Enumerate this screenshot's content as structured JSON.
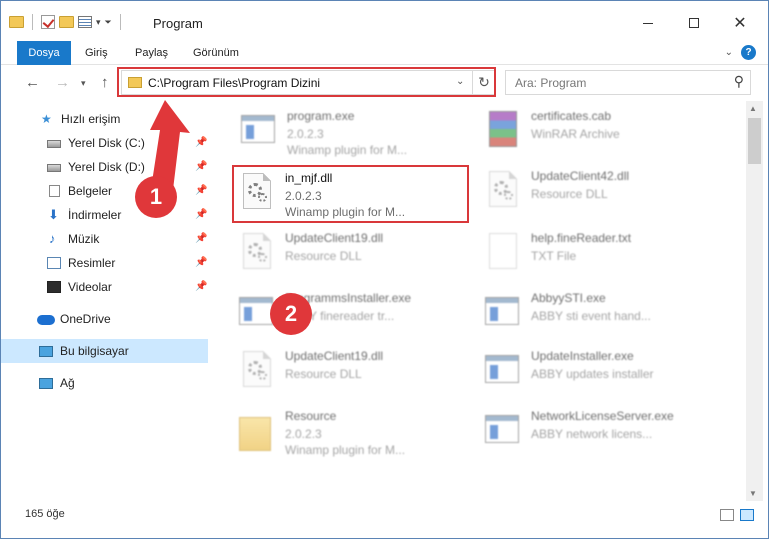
{
  "window": {
    "title": "Program"
  },
  "ribbon": {
    "tabs": [
      "Dosya",
      "Giriş",
      "Paylaş",
      "Görünüm"
    ],
    "help": "?"
  },
  "nav": {
    "address": "C:\\Program Files\\Program Dizini",
    "search_placeholder": "Ara: Program"
  },
  "sidebar": {
    "items": [
      {
        "label": "Hızlı erişim",
        "icon": "star-icon"
      },
      {
        "label": "Yerel Disk (C:)",
        "icon": "drive-icon"
      },
      {
        "label": "Yerel Disk (D:)",
        "icon": "drive-icon"
      },
      {
        "label": "Belgeler",
        "icon": "documents-icon"
      },
      {
        "label": "İndirmeler",
        "icon": "download-icon"
      },
      {
        "label": "Müzik",
        "icon": "music-icon"
      },
      {
        "label": "Resimler",
        "icon": "pictures-icon"
      },
      {
        "label": "Videolar",
        "icon": "videos-icon"
      },
      {
        "label": "OneDrive",
        "icon": "cloud-icon"
      },
      {
        "label": "Bu bilgisayar",
        "icon": "computer-icon"
      },
      {
        "label": "Ağ",
        "icon": "network-icon"
      }
    ]
  },
  "files": {
    "left": [
      {
        "name": "program.exe",
        "line2": "2.0.2.3",
        "line3": "Winamp plugin for M..."
      },
      {
        "name": "in_mjf.dll",
        "line2": "2.0.2.3",
        "line3": "Winamp plugin for M..."
      },
      {
        "name": "UpdateClient19.dll",
        "line2": "Resource DLL",
        "line3": ""
      },
      {
        "name": "ProgrammsInstaller.exe",
        "line2": "ABBY finereader tr...",
        "line3": ""
      },
      {
        "name": "UpdateClient19.dll",
        "line2": "Resource DLL",
        "line3": ""
      },
      {
        "name": "Resource",
        "line2": "2.0.2.3",
        "line3": "Winamp plugin for M..."
      }
    ],
    "right": [
      {
        "name": "certificates.cab",
        "line2": "WinRAR Archive",
        "line3": ""
      },
      {
        "name": "UpdateClient42.dll",
        "line2": "Resource DLL",
        "line3": ""
      },
      {
        "name": "help.fineReader.txt",
        "line2": "TXT File",
        "line3": ""
      },
      {
        "name": "AbbyySTI.exe",
        "line2": "ABBY sti event hand...",
        "line3": ""
      },
      {
        "name": "UpdateInstaller.exe",
        "line2": "ABBY updates installer",
        "line3": ""
      },
      {
        "name": "NetworkLicenseServer.exe",
        "line2": "ABBY network licens...",
        "line3": ""
      }
    ]
  },
  "status": {
    "count": "165 öğe"
  },
  "callouts": [
    "1",
    "2"
  ],
  "colors": {
    "accent": "#1979ca",
    "highlight": "#d9383a",
    "selected": "#cce8ff"
  }
}
